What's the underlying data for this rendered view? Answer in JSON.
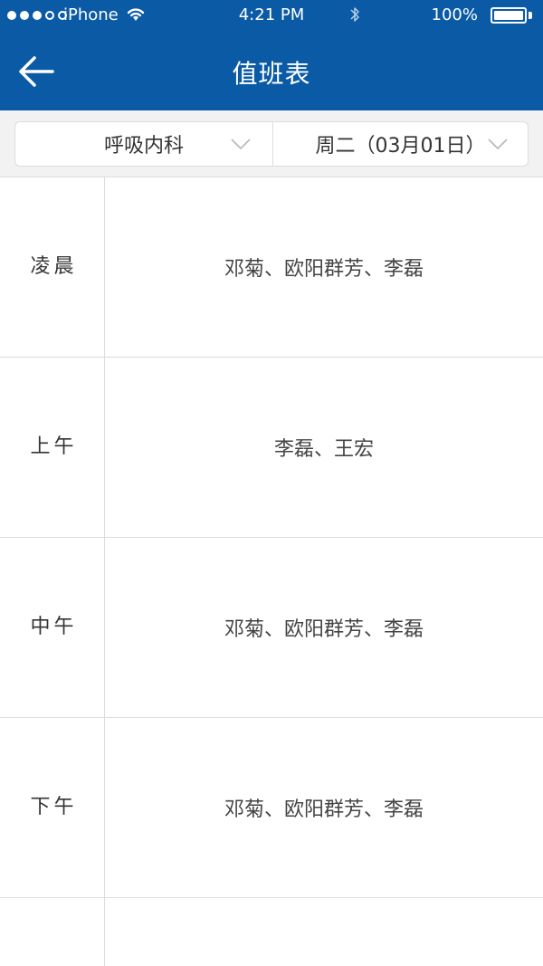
{
  "status_bar": {
    "carrier": "iPhone",
    "time": "4:21 PM",
    "battery": "100%",
    "battery_level": 1.0
  },
  "nav": {
    "title": "值班表"
  },
  "filters": {
    "department": "呼吸内科",
    "date": "周二（03月01日）"
  },
  "schedule": [
    {
      "label_line1": "凌",
      "label_line2": "晨",
      "names": "邓菊、欧阳群芳、李磊"
    },
    {
      "label_line1": "上",
      "label_line2": "午",
      "names": "李磊、王宏"
    },
    {
      "label_line1": "中",
      "label_line2": "午",
      "names": "邓菊、欧阳群芳、李磊"
    },
    {
      "label_line1": "下",
      "label_line2": "午",
      "names": "邓菊、欧阳群芳、李磊"
    },
    {
      "label_line1": "",
      "label_line2": "",
      "names": ""
    }
  ],
  "colors": {
    "brand": "#0b5aa6",
    "background": "#f2f2f2",
    "divider": "#dcdcdc",
    "text": "#333333"
  },
  "icons": {
    "back": "arrow-left-icon",
    "dropdown": "chevron-down-icon",
    "wifi": "wifi-icon",
    "bluetooth": "bluetooth-icon",
    "battery": "battery-icon"
  }
}
